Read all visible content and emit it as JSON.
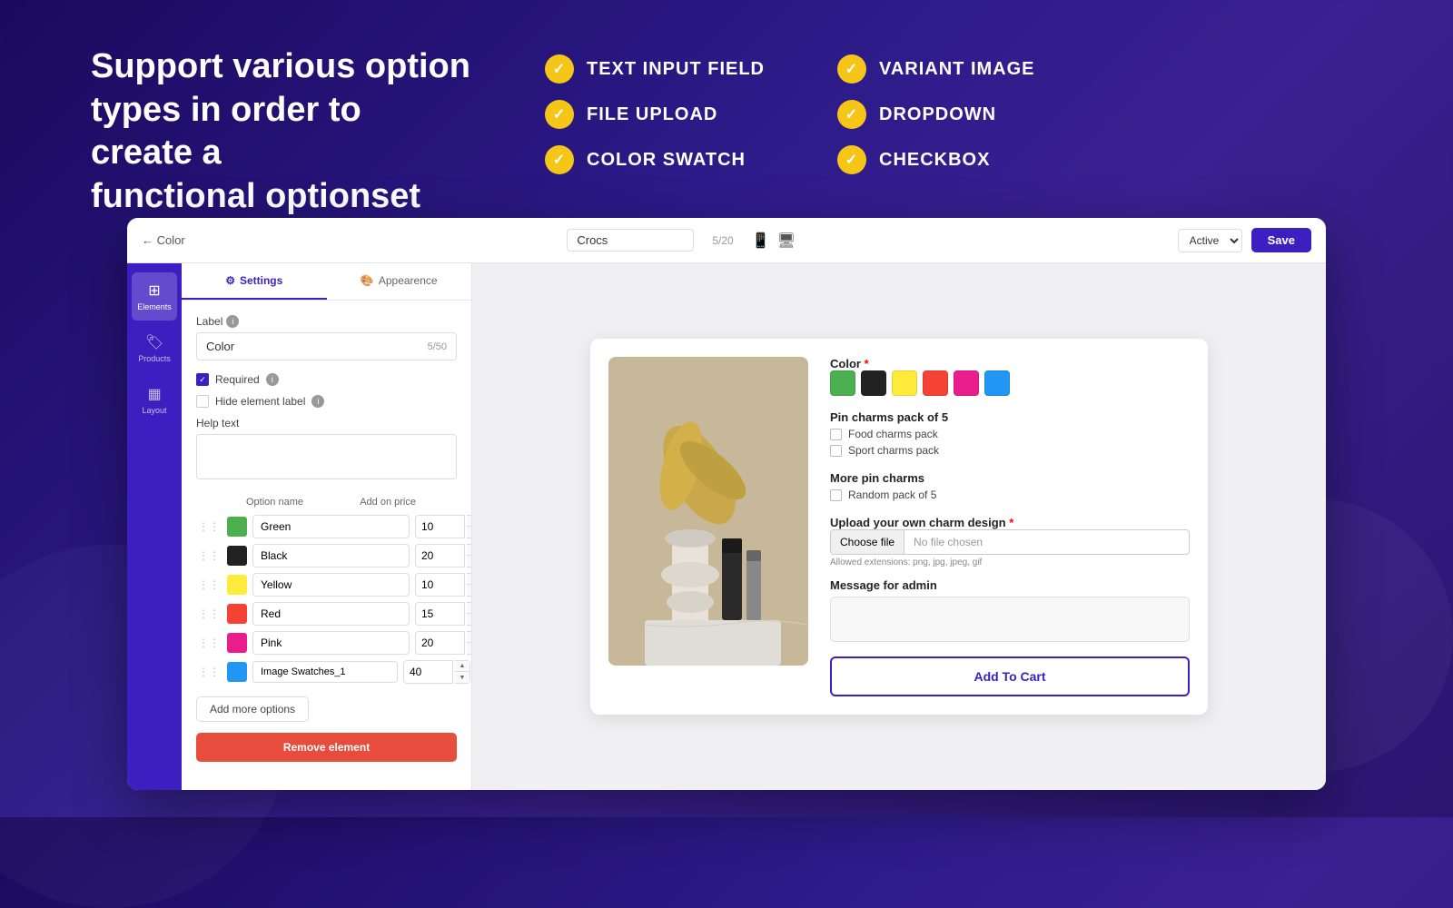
{
  "background": {
    "gradient": "linear-gradient(135deg, #1a0a5e, #2d1b8a, #2a1570)"
  },
  "headline": {
    "line1": "Support various option",
    "line2": "types in order to create a",
    "line3": "functional optionset"
  },
  "features": [
    {
      "id": "text-input",
      "label": "TEXT INPUT FIELD"
    },
    {
      "id": "variant-image",
      "label": "VARIANT IMAGE"
    },
    {
      "id": "file-upload",
      "label": "FILE UPLOAD"
    },
    {
      "id": "dropdown",
      "label": "DROPDOWN"
    },
    {
      "id": "color-swatch",
      "label": "COLOR SWATCH"
    },
    {
      "id": "checkbox",
      "label": "CHECKBOX"
    }
  ],
  "topbar": {
    "back_label": "← Color",
    "page_name": "Crocs",
    "char_count": "5/20",
    "status_label": "Active",
    "save_label": "Save"
  },
  "sidebar": {
    "items": [
      {
        "id": "elements",
        "label": "Elements",
        "icon": "⊞",
        "active": true
      },
      {
        "id": "products",
        "label": "Products",
        "icon": "🏷",
        "active": false
      },
      {
        "id": "layout",
        "label": "Layout",
        "icon": "▦",
        "active": false
      }
    ]
  },
  "settings_panel": {
    "tabs": [
      {
        "id": "settings",
        "label": "Settings",
        "active": true
      },
      {
        "id": "appearance",
        "label": "Appearence",
        "active": false
      }
    ],
    "label_field": {
      "label": "Label",
      "value": "Color",
      "char_count": "5/50"
    },
    "required": {
      "label": "Required",
      "checked": true
    },
    "hide_label": {
      "label": "Hide element label",
      "checked": false
    },
    "help_text": {
      "label": "Help text",
      "value": ""
    },
    "options": {
      "col1": "Option name",
      "col2": "Add on price",
      "rows": [
        {
          "name": "Green",
          "price": "10",
          "color": "#4caf50"
        },
        {
          "name": "Black",
          "price": "20",
          "color": "#222222"
        },
        {
          "name": "Yellow",
          "price": "10",
          "color": "#ffeb3b"
        },
        {
          "name": "Red",
          "price": "15",
          "color": "#f44336"
        },
        {
          "name": "Pink",
          "price": "20",
          "color": "#e91e8c"
        },
        {
          "name": "Image Swatches_1",
          "price": "40",
          "color": "#2196f3"
        }
      ]
    },
    "add_more_label": "Add more options",
    "remove_label": "Remove element"
  },
  "preview": {
    "color_label": "Color",
    "required_label": "*",
    "swatches": [
      {
        "color": "#4caf50",
        "title": "Green"
      },
      {
        "color": "#222222",
        "title": "Black"
      },
      {
        "color": "#ffeb3b",
        "title": "Yellow"
      },
      {
        "color": "#f44336",
        "title": "Red"
      },
      {
        "color": "#e91e8c",
        "title": "Pink"
      },
      {
        "color": "#2196f3",
        "title": "Image Swatches_1"
      }
    ],
    "pin_charms_title": "Pin charms pack of 5",
    "pin_options": [
      "Food charms pack",
      "Sport charms pack"
    ],
    "more_pin_title": "More pin charms",
    "more_pin_options": [
      "Random pack of 5"
    ],
    "upload_label": "Upload your own charm design",
    "upload_required": "*",
    "choose_file_label": "Choose file",
    "no_file_text": "No file chosen",
    "allowed_ext_label": "Allowed extensions: png, jpg, jpeg, gif",
    "message_label": "Message for admin",
    "add_to_cart_label": "Add To Cart"
  }
}
